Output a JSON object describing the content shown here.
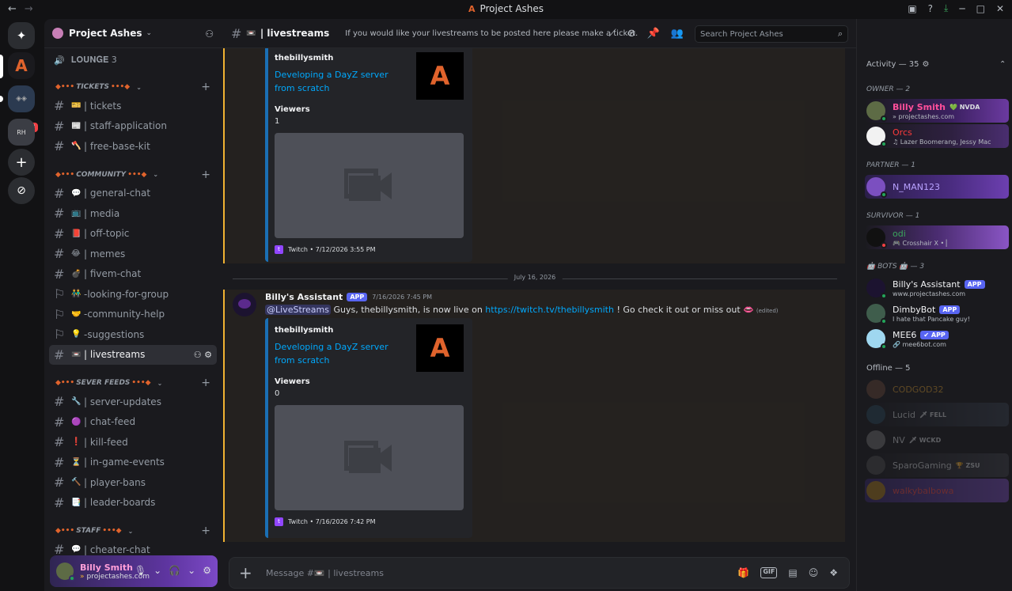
{
  "titlebar": {
    "title": "Project Ashes",
    "logo": "A",
    "back": "←",
    "forward": "→",
    "icons": [
      "inbox-icon",
      "help-icon",
      "download-icon",
      "minimize-icon",
      "maximize-icon",
      "close-icon"
    ],
    "icon_glyphs": [
      "▣",
      "?",
      "⤓",
      "─",
      "□",
      "✕"
    ]
  },
  "rail": {
    "home_glyph": "✦",
    "active_server": "A",
    "folder1_badge": "18",
    "folder2_label": "RH",
    "add_glyph": "+",
    "explore_glyph": "⊘"
  },
  "server": {
    "name": "Project Ashes",
    "chev": "⌄",
    "invite_glyph": "⚇"
  },
  "voice": {
    "icon": "🔊",
    "name": "𝐋𝐎𝐔𝐍𝐆𝐄 3"
  },
  "categories": [
    {
      "name": "TICKETS",
      "decor": "◆•••",
      "decor_end": "•••◆",
      "chev": "⌄",
      "plus": "+",
      "channels": [
        {
          "hash": "#",
          "emoji": "🎫",
          "name": "| tickets"
        },
        {
          "hash": "#",
          "emoji": "📰",
          "name": "| staff-application"
        },
        {
          "hash": "#",
          "emoji": "🪓",
          "name": "| free-base-kit"
        }
      ]
    },
    {
      "name": "COMMUNITY",
      "decor": "◆•••",
      "decor_end": "•••◆",
      "chev": "⌄",
      "plus": "+",
      "channels": [
        {
          "hash": "#",
          "emoji": "💬",
          "name": "| general-chat"
        },
        {
          "hash": "#",
          "emoji": "📺",
          "name": "| media"
        },
        {
          "hash": "#",
          "emoji": "📕",
          "name": "| off-topic"
        },
        {
          "hash": "#",
          "emoji": "😂",
          "name": "| memes"
        },
        {
          "hash": "#",
          "emoji": "💣",
          "name": "| fivem-chat"
        },
        {
          "hash": "⚐",
          "emoji": "👬",
          "name": "-looking-for-group"
        },
        {
          "hash": "⚐",
          "emoji": "🤝",
          "name": "-community-help"
        },
        {
          "hash": "⚐",
          "emoji": "💡",
          "name": "-suggestions"
        },
        {
          "hash": "#",
          "emoji": "📼",
          "name": "| livestreams",
          "active": true
        }
      ]
    },
    {
      "name": "SEVER FEEDS",
      "decor": "◆•••",
      "decor_end": "•••◆",
      "chev": "⌄",
      "plus": "+",
      "channels": [
        {
          "hash": "#",
          "emoji": "🔧",
          "name": "| server-updates"
        },
        {
          "hash": "#",
          "emoji": "🟣",
          "name": "| chat-feed"
        },
        {
          "hash": "#",
          "emoji": "❗",
          "name": "| kill-feed"
        },
        {
          "hash": "#",
          "emoji": "⏳",
          "name": "| in-game-events"
        },
        {
          "hash": "#",
          "emoji": "🔨",
          "name": "| player-bans"
        },
        {
          "hash": "#",
          "emoji": "📑",
          "name": "| leader-boards"
        }
      ]
    },
    {
      "name": "STAFF",
      "decor": "◆•••",
      "decor_end": "•••◆",
      "chev": "⌄",
      "plus": "+",
      "channels": [
        {
          "hash": "#",
          "emoji": "💬",
          "name": "| cheater-chat"
        }
      ]
    }
  ],
  "active_channel_tools": "⚇ ⚙",
  "user": {
    "display_name": "Billy Smith",
    "status": "projectashes.com",
    "status_glyph": "»",
    "mic": "🎙",
    "headset": "🎧",
    "settings": "⚙",
    "chev": "⌄"
  },
  "channel_header": {
    "hash": "#",
    "emoji": "📼",
    "name": "| livestreams",
    "topic": "If you would like your livestreams to be posted here please make a ticket.",
    "tools": [
      "threads-icon",
      "mute-icon",
      "pin-icon",
      "members-icon"
    ],
    "tool_glyphs": [
      "⟋",
      "⊘",
      "📌",
      "👥"
    ],
    "search_placeholder": "Search Project Ashes",
    "search_glyph": "⌕"
  },
  "messages": [
    {
      "embed": {
        "author": "thebillysmith",
        "title": "Developing a DayZ server from scratch",
        "field_label": "Viewers",
        "field_value": "1",
        "footer": "Twitch • 7/12/2026 3:55 PM",
        "thumb": "A"
      }
    },
    {
      "date_divider": "July 16, 2026",
      "author": "Billy's Assistant",
      "app_tag": "APP",
      "timestamp": "7/16/2026 7:45 PM",
      "mention": "@LiveStreams",
      "text_before": " Guys, thebillysmith, is now live on ",
      "link": "https://twitch.tv/thebillysmith",
      "text_after": " ! Go check it out or miss out ",
      "emoji": "👄",
      "edited": "(edited)",
      "embed": {
        "author": "thebillysmith",
        "title": "Developing a DayZ server from scratch",
        "field_label": "Viewers",
        "field_value": "0",
        "footer": "Twitch • 7/16/2026 7:42 PM",
        "thumb": "A"
      }
    }
  ],
  "composer": {
    "plus": "+",
    "placeholder": "Message #📼 | livestreams",
    "tools": [
      "gift-icon",
      "gif-icon",
      "sticker-icon",
      "emoji-icon",
      "apps-icon"
    ],
    "tool_glyphs": [
      "🎁",
      "GIF",
      "▤",
      "☺",
      "❖"
    ]
  },
  "members": {
    "activity_label": "Activity — 35",
    "activity_gear": "⚙",
    "collapse": "⌃",
    "groups": [
      {
        "label": "OWNER — 2",
        "members": [
          {
            "name": "Billy Smith",
            "color": "#ff4f9a",
            "tag": "💚 NVDA",
            "status": "» projectashes.com",
            "avatar": "#5d6b45",
            "bg": "linear-gradient(90deg,#1a1a1e,#3b2060 60%,#6b3aa0)"
          },
          {
            "name": "Orcs",
            "color": "#ff3b3b",
            "tag": "",
            "status": "♫ Lazer Boomerang, Jessy Mac",
            "avatar": "#f2f2f2",
            "bg": "linear-gradient(90deg,#1a1a1e,#2e2040 60%,#4a2e70)"
          }
        ]
      },
      {
        "label": "PARTNER — 1",
        "members": [
          {
            "name": "N_MAN123",
            "color": "#b9a2ff",
            "tag": "",
            "status": "",
            "avatar": "#7b4fc0",
            "bg": "linear-gradient(90deg,#2a1e48,#4a2c80 60%,#6c3fb0)"
          }
        ]
      },
      {
        "label": "SURVIVOR — 1",
        "members": [
          {
            "name": "odi",
            "color": "#3ba55c",
            "tag": "",
            "status": "🎮 Crosshair X • ▏",
            "avatar": "#111111",
            "bg": "linear-gradient(90deg,#1a1a1e,#4a2c70 50%,#8a55c5)",
            "dnd": true
          }
        ]
      },
      {
        "label": "🤖 BOTS 🤖 — 3",
        "members": [
          {
            "name": "Billy's Assistant",
            "color": "#f2f3f5",
            "tag": "APP",
            "status": "www.projectashes.com",
            "avatar": "#1c1330",
            "bg": "none"
          },
          {
            "name": "DimbyBot",
            "color": "#f2f3f5",
            "tag": "APP",
            "status": "I hate that Pancake guy!",
            "avatar": "#3f5d4c",
            "bg": "none"
          },
          {
            "name": "MEE6",
            "color": "#f2f3f5",
            "tag": "✔ APP",
            "status": "🔗 mee6bot.com",
            "avatar": "#9fd7f0",
            "bg": "none"
          }
        ]
      },
      {
        "label": "Offline — 5",
        "offline": true,
        "members": [
          {
            "name": "CODGOD32",
            "color": "#e0a030",
            "tag": "",
            "status": "",
            "avatar": "#6b4a3a",
            "bg": "none"
          },
          {
            "name": "Lucid",
            "color": "#dbdee1",
            "tag": "🗡 FELL",
            "status": "",
            "avatar": "#2a4a5a",
            "bg": "linear-gradient(90deg,#1a1a1e,#3a4250)"
          },
          {
            "name": "NV",
            "color": "#dbdee1",
            "tag": "🗡 WCKD",
            "status": "",
            "avatar": "#777777",
            "bg": "none"
          },
          {
            "name": "SparoGaming",
            "color": "#dbdee1",
            "tag": "🏆 ZSU",
            "status": "",
            "avatar": "#505050",
            "bg": "linear-gradient(90deg,#1a1a1e,#40424a)"
          },
          {
            "name": "walkybalbowa",
            "color": "#ff5050",
            "tag": "",
            "status": "",
            "avatar": "#b08020",
            "bg": "linear-gradient(90deg,#3a2a70,#7b4fc0)"
          }
        ]
      }
    ]
  }
}
